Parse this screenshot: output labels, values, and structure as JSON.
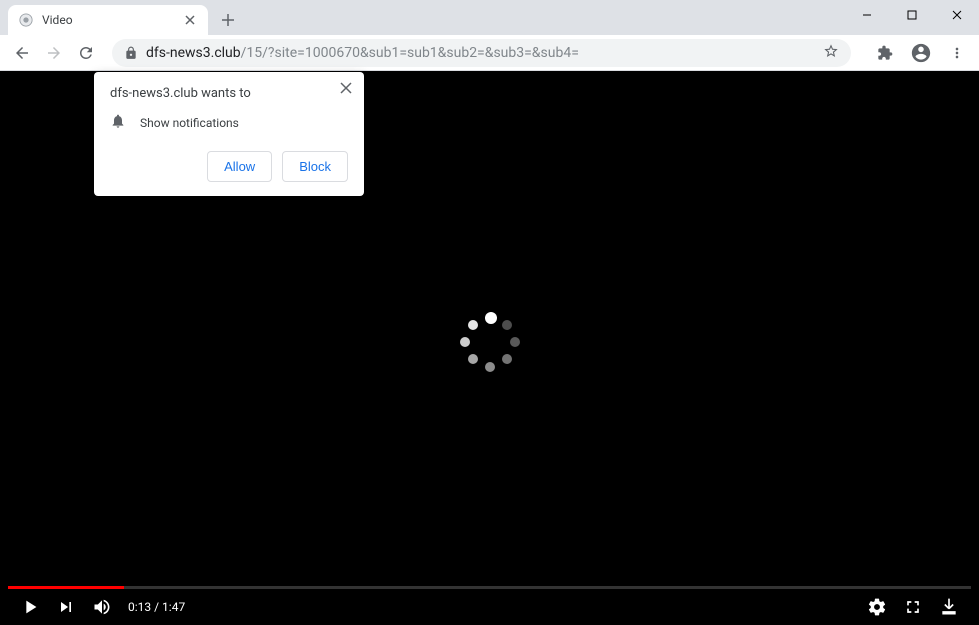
{
  "tab": {
    "title": "Video"
  },
  "url": {
    "domain": "dfs-news3.club",
    "path": "/15/?site=1000670&sub1=sub1&sub2=&sub3=&sub4="
  },
  "notification": {
    "title": "dfs-news3.club wants to",
    "permission_text": "Show notifications",
    "allow_label": "Allow",
    "block_label": "Block"
  },
  "video": {
    "time_display": "0:13 / 1:47",
    "progress_percent": 12
  }
}
